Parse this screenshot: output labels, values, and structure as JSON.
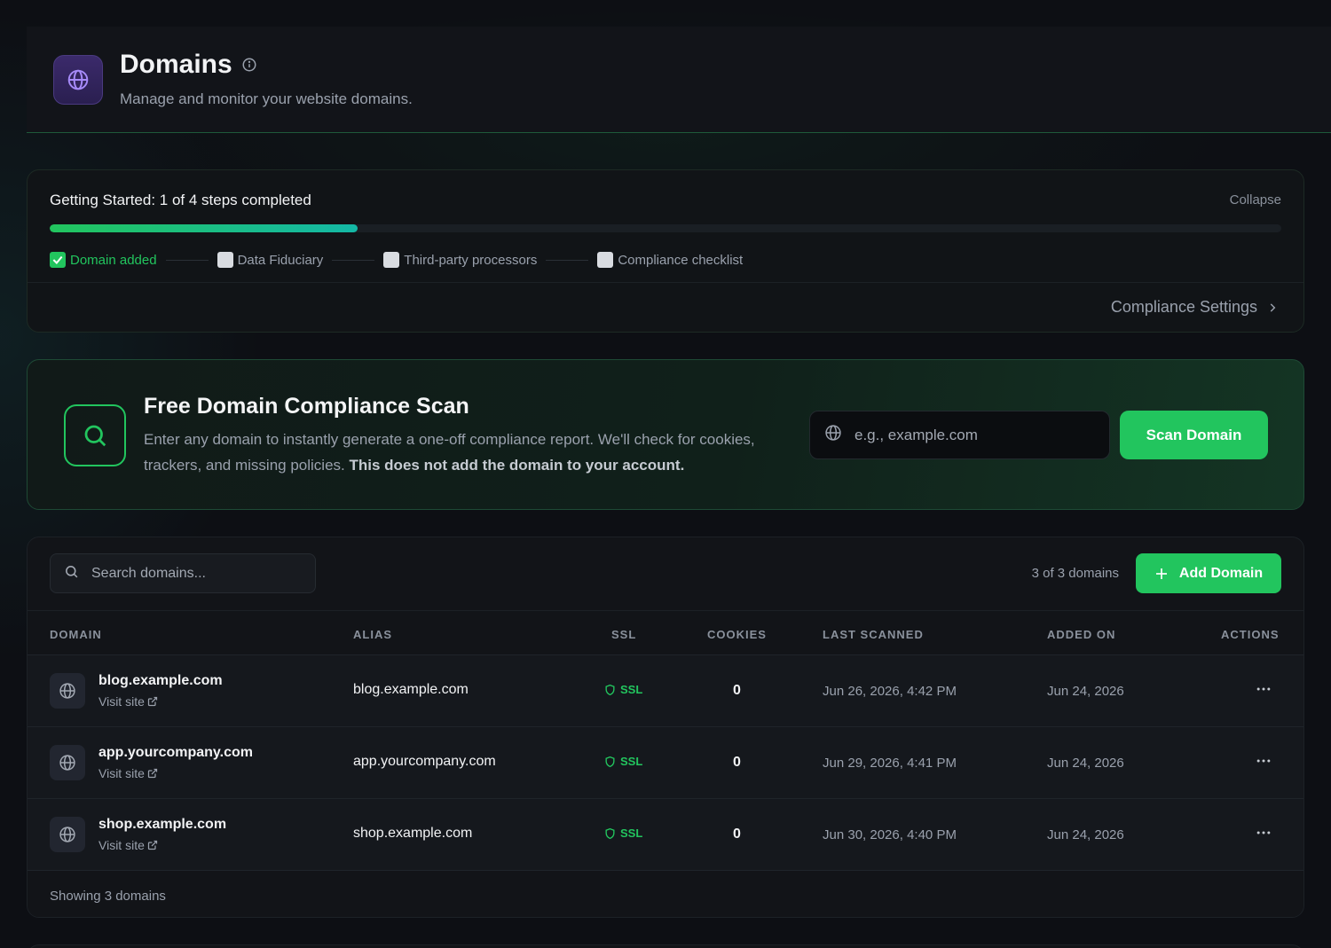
{
  "header": {
    "title": "Domains",
    "subtitle": "Manage and monitor your website domains.",
    "icon": "globe-icon"
  },
  "getting_started": {
    "title": "Getting Started: 1 of 4 steps completed",
    "collapse_label": "Collapse",
    "progress": 0.25,
    "steps": [
      {
        "label": "Domain added",
        "done": true
      },
      {
        "label": "Data Fiduciary",
        "done": false
      },
      {
        "label": "Third-party processors",
        "done": false
      },
      {
        "label": "Compliance checklist",
        "done": false
      }
    ],
    "settings_link": "Compliance Settings"
  },
  "scan": {
    "title": "Free Domain Compliance Scan",
    "description": "Enter any domain to instantly generate a one-off compliance report. We'll check for cookies, trackers, and missing policies.",
    "description_bold": "This does not add the domain to your account.",
    "input_placeholder": "e.g., example.com",
    "button_label": "Scan Domain"
  },
  "table": {
    "search_placeholder": "Search domains...",
    "count_text": "3 of 3 domains",
    "add_button_label": "Add Domain",
    "columns": [
      "DOMAIN",
      "ALIAS",
      "SSL",
      "COOKIES",
      "LAST SCANNED",
      "ADDED ON",
      "ACTIONS"
    ],
    "rows": [
      {
        "domain": "blog.example.com",
        "visit": "Visit site",
        "alias": "blog.example.com",
        "ssl": "SSL",
        "cookies": "0",
        "last_scanned": "Jun 26, 2026, 4:42 PM",
        "added_on": "Jun 24, 2026"
      },
      {
        "domain": "app.yourcompany.com",
        "visit": "Visit site",
        "alias": "app.yourcompany.com",
        "ssl": "SSL",
        "cookies": "0",
        "last_scanned": "Jun 29, 2026, 4:41 PM",
        "added_on": "Jun 24, 2026"
      },
      {
        "domain": "shop.example.com",
        "visit": "Visit site",
        "alias": "shop.example.com",
        "ssl": "SSL",
        "cookies": "0",
        "last_scanned": "Jun 30, 2026, 4:40 PM",
        "added_on": "Jun 24, 2026"
      }
    ],
    "footer": "Showing 3 domains"
  },
  "colors": {
    "accent": "#22c55e",
    "accent_teal": "#14b8a6",
    "header_icon_bg": "#3b2a6b",
    "background": "#0d0f14"
  }
}
